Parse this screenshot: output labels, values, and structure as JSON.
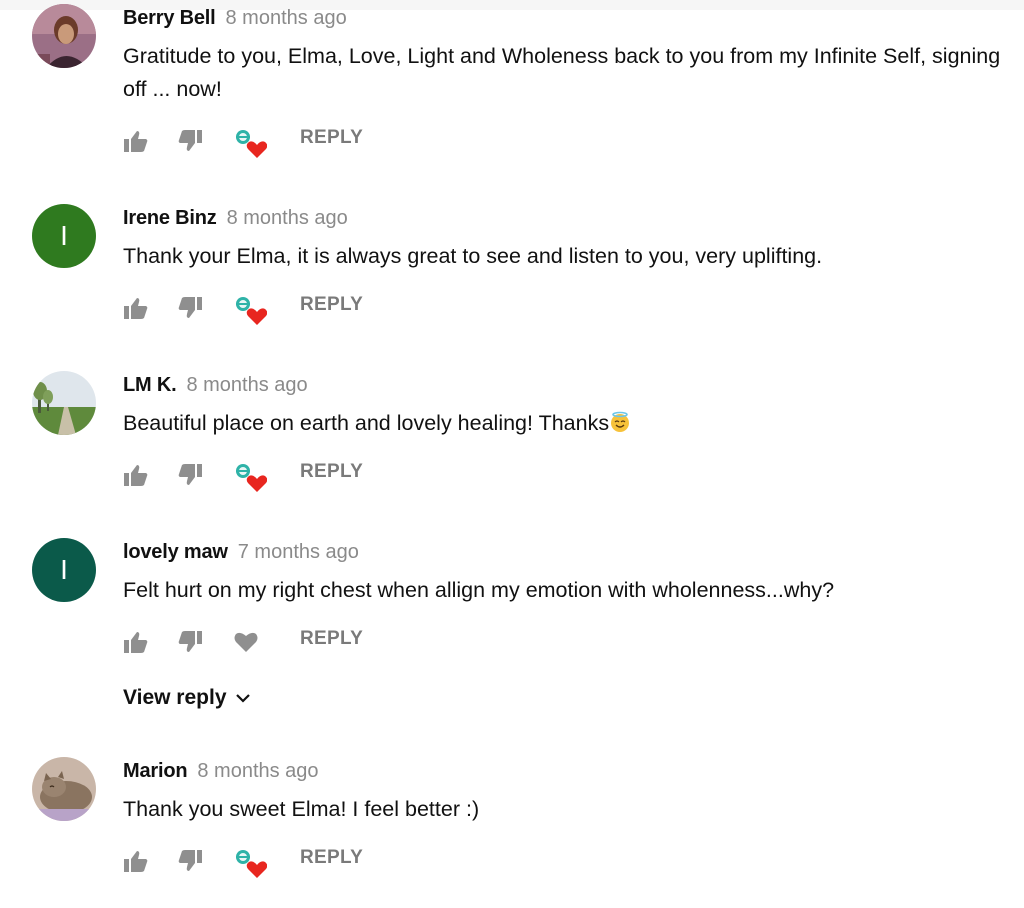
{
  "comments": [
    {
      "author": "Berry Bell",
      "time": "8 months ago",
      "text": "Gratitude to you, Elma, Love, Light and Wholeness back to you from my Infinite Self, signing off ... now!",
      "avatar_type": "photo-person",
      "heart_type": "creator-heart",
      "reply_label": "REPLY"
    },
    {
      "author": "Irene Binz",
      "time": "8 months ago",
      "text": "Thank your Elma, it is always great to see and listen to you, very uplifting.",
      "avatar_type": "letter",
      "avatar_letter": "I",
      "avatar_color": "#2f7a1f",
      "heart_type": "creator-heart",
      "reply_label": "REPLY"
    },
    {
      "author": "LM K.",
      "time": "8 months ago",
      "text": "Beautiful place on earth and lovely healing! Thanks",
      "emoji": "smiling-face-with-halo",
      "avatar_type": "photo-landscape",
      "heart_type": "creator-heart",
      "reply_label": "REPLY"
    },
    {
      "author": "lovely maw",
      "time": "7 months ago",
      "text": "Felt hurt on my right chest when allign my emotion with wholenness...why?",
      "avatar_type": "letter",
      "avatar_letter": "I",
      "avatar_color": "#0b5a4a",
      "heart_type": "plain-heart",
      "reply_label": "REPLY",
      "view_reply_label": "View reply"
    },
    {
      "author": "Marion",
      "time": "8 months ago",
      "text": "Thank you sweet Elma! I feel better :)",
      "avatar_type": "photo-cat",
      "heart_type": "creator-heart",
      "reply_label": "REPLY"
    }
  ],
  "icons": {
    "like": "thumbs-up-icon",
    "dislike": "thumbs-down-icon",
    "creator_heart": "creator-heart-icon",
    "heart": "heart-icon",
    "chevron": "chevron-down-icon"
  },
  "colors": {
    "heart_red": "#e8261f",
    "icon_gray": "#8f8f8f",
    "timestamp_gray": "#8a8a8a"
  }
}
